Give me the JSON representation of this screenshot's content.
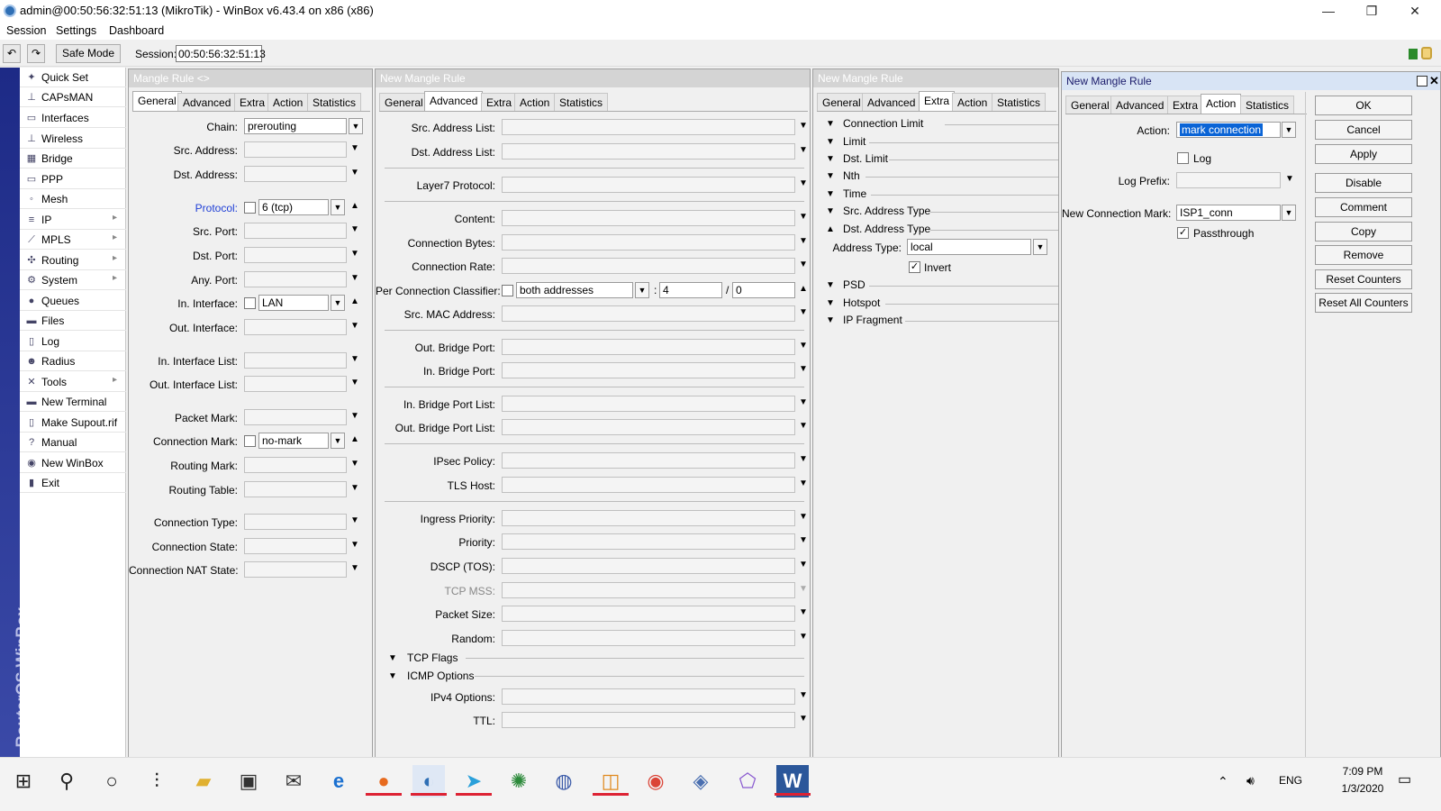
{
  "window": {
    "title": "admin@00:50:56:32:51:13 (MikroTik) - WinBox v6.43.4 on x86 (x86)",
    "minimize": "—",
    "maximize": "❐",
    "close": "✕"
  },
  "menubar": [
    "Session",
    "Settings",
    "Dashboard"
  ],
  "toolbar": {
    "undo": "↶",
    "redo": "↷",
    "safe_mode": "Safe Mode",
    "session_label": "Session:",
    "session_value": "00:50:56:32:51:13"
  },
  "sidebar_strip": "RouterOS WinBox",
  "sidebar": [
    {
      "label": "Quick Set",
      "icon": "quickset-icon",
      "glyph": "✦",
      "sub": false
    },
    {
      "label": "CAPsMAN",
      "icon": "capsman-icon",
      "glyph": "⊥",
      "sub": false
    },
    {
      "label": "Interfaces",
      "icon": "interfaces-icon",
      "glyph": "▭",
      "sub": false
    },
    {
      "label": "Wireless",
      "icon": "wireless-icon",
      "glyph": "⊥",
      "sub": false
    },
    {
      "label": "Bridge",
      "icon": "bridge-icon",
      "glyph": "▦",
      "sub": false
    },
    {
      "label": "PPP",
      "icon": "ppp-icon",
      "glyph": "▭",
      "sub": false
    },
    {
      "label": "Mesh",
      "icon": "mesh-icon",
      "glyph": "◦",
      "sub": false
    },
    {
      "label": "IP",
      "icon": "ip-icon",
      "glyph": "≡",
      "sub": true
    },
    {
      "label": "MPLS",
      "icon": "mpls-icon",
      "glyph": "⟋",
      "sub": true
    },
    {
      "label": "Routing",
      "icon": "routing-icon",
      "glyph": "✣",
      "sub": true
    },
    {
      "label": "System",
      "icon": "system-icon",
      "glyph": "⚙",
      "sub": true
    },
    {
      "label": "Queues",
      "icon": "queues-icon",
      "glyph": "●",
      "sub": false
    },
    {
      "label": "Files",
      "icon": "files-icon",
      "glyph": "▬",
      "sub": false
    },
    {
      "label": "Log",
      "icon": "log-icon",
      "glyph": "▯",
      "sub": false
    },
    {
      "label": "Radius",
      "icon": "radius-icon",
      "glyph": "☻",
      "sub": false
    },
    {
      "label": "Tools",
      "icon": "tools-icon",
      "glyph": "✕",
      "sub": true
    },
    {
      "label": "New Terminal",
      "icon": "terminal-icon",
      "glyph": "▬",
      "sub": false
    },
    {
      "label": "Make Supout.rif",
      "icon": "supout-icon",
      "glyph": "▯",
      "sub": false
    },
    {
      "label": "Manual",
      "icon": "manual-icon",
      "glyph": "?",
      "sub": false
    },
    {
      "label": "New WinBox",
      "icon": "winbox-icon",
      "glyph": "◉",
      "sub": false
    },
    {
      "label": "Exit",
      "icon": "exit-icon",
      "glyph": "▮",
      "sub": false
    }
  ],
  "win1": {
    "title": "Mangle Rule <>",
    "tabs": [
      "General",
      "Advanced",
      "Extra",
      "Action",
      "Statistics"
    ],
    "fields": {
      "chain": {
        "label": "Chain:",
        "value": "prerouting"
      },
      "src_address": "Src. Address:",
      "dst_address": "Dst. Address:",
      "protocol": {
        "label": "Protocol:",
        "value": "6 (tcp)"
      },
      "src_port": "Src. Port:",
      "dst_port": "Dst. Port:",
      "any_port": "Any. Port:",
      "in_interface": {
        "label": "In. Interface:",
        "value": "LAN"
      },
      "out_interface": "Out. Interface:",
      "in_interface_list": "In. Interface List:",
      "out_interface_list": "Out. Interface List:",
      "packet_mark": "Packet Mark:",
      "connection_mark": {
        "label": "Connection Mark:",
        "value": "no-mark"
      },
      "routing_mark": "Routing Mark:",
      "routing_table": "Routing Table:",
      "connection_type": "Connection Type:",
      "connection_state": "Connection State:",
      "connection_nat_state": "Connection NAT State:"
    }
  },
  "win2": {
    "title": "New Mangle Rule",
    "tabs": [
      "General",
      "Advanced",
      "Extra",
      "Action",
      "Statistics"
    ],
    "fields": {
      "src_address_list": "Src. Address List:",
      "dst_address_list": "Dst. Address List:",
      "layer7": "Layer7 Protocol:",
      "content": "Content:",
      "connection_bytes": "Connection Bytes:",
      "connection_rate": "Connection Rate:",
      "pcc": {
        "label": "Per Connection Classifier:",
        "value": "both addresses",
        "sep1": ":",
        "val2": "4",
        "sep2": "/",
        "val3": "0"
      },
      "src_mac": "Src. MAC Address:",
      "out_bridge_port": "Out. Bridge Port:",
      "in_bridge_port": "In. Bridge Port:",
      "in_bridge_port_list": "In. Bridge Port List:",
      "out_bridge_port_list": "Out. Bridge Port List:",
      "ipsec_policy": "IPsec Policy:",
      "tls_host": "TLS Host:",
      "ingress_priority": "Ingress Priority:",
      "priority": "Priority:",
      "dscp": "DSCP (TOS):",
      "tcp_mss": "TCP MSS:",
      "packet_size": "Packet Size:",
      "random": "Random:",
      "tcp_flags": "TCP Flags",
      "icmp_options": "ICMP Options",
      "ipv4_options": "IPv4 Options:",
      "ttl": "TTL:"
    }
  },
  "win3": {
    "title": "New Mangle Rule",
    "tabs": [
      "General",
      "Advanced",
      "Extra",
      "Action",
      "Statistics"
    ],
    "sections": [
      "Connection Limit",
      "Limit",
      "Dst. Limit",
      "Nth",
      "Time",
      "Src. Address Type",
      "Dst. Address Type"
    ],
    "address_type": {
      "label": "Address Type:",
      "value": "local"
    },
    "invert": "Invert",
    "sections2": [
      "PSD",
      "Hotspot",
      "IP Fragment"
    ]
  },
  "win4": {
    "title": "New Mangle Rule",
    "tabs": [
      "General",
      "Advanced",
      "Extra",
      "Action",
      "Statistics"
    ],
    "action": {
      "label": "Action:",
      "value": "mark connection"
    },
    "log": "Log",
    "log_prefix": "Log Prefix:",
    "new_conn_mark": {
      "label": "New Connection Mark:",
      "value": "ISP1_conn"
    },
    "passthrough": "Passthrough",
    "buttons": [
      "OK",
      "Cancel",
      "Apply",
      "Disable",
      "Comment",
      "Copy",
      "Remove",
      "Reset Counters",
      "Reset All Counters"
    ]
  },
  "taskbar": {
    "time": "7:09 PM",
    "date": "1/3/2020",
    "lang": "ENG"
  },
  "colors": {
    "strip": "#1d2a86",
    "link_blue": "#1f3fd6",
    "selection": "#0a64d6"
  }
}
